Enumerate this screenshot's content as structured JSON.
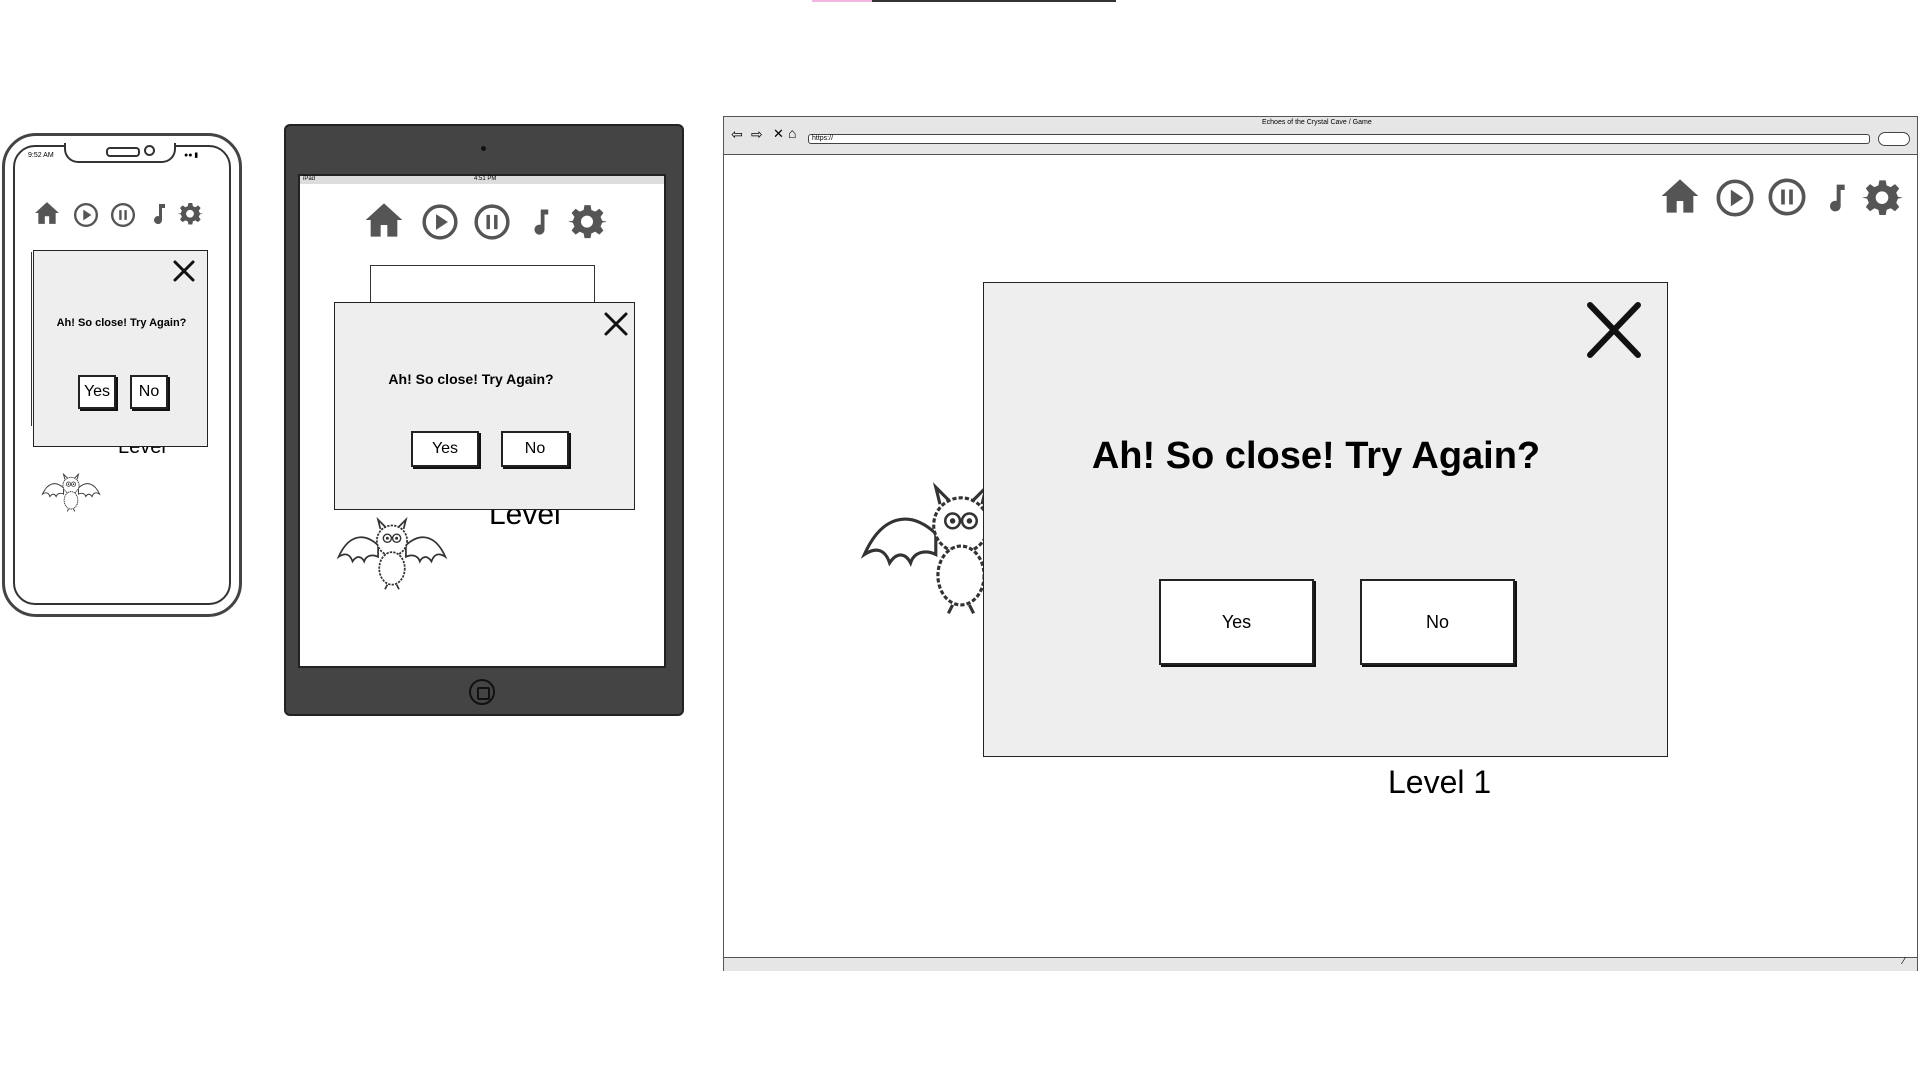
{
  "browser": {
    "title": "Echoes of the Crystal Cave / Game",
    "url": "https://"
  },
  "phone": {
    "status_time": "9:52 AM",
    "dialog_message": "Ah! So close! Try Again?",
    "yes_label": "Yes",
    "no_label": "No",
    "level_label": "Level"
  },
  "tablet": {
    "status_device": "iPad",
    "status_time": "4:51 PM",
    "dialog_message": "Ah! So close! Try Again?",
    "yes_label": "Yes",
    "no_label": "No",
    "level_label": "Level"
  },
  "desktop": {
    "dialog_message": "Ah! So close! Try Again?",
    "yes_label": "Yes",
    "no_label": "No",
    "level_label": "Level 1"
  },
  "icons": [
    "home-icon",
    "play-icon",
    "pause-icon",
    "music-icon",
    "gear-icon"
  ],
  "colors": {
    "icon": "#555555",
    "dialog_bg": "#eeeeee",
    "device_frame": "#444444",
    "browser_chrome": "#e6e6e6"
  }
}
